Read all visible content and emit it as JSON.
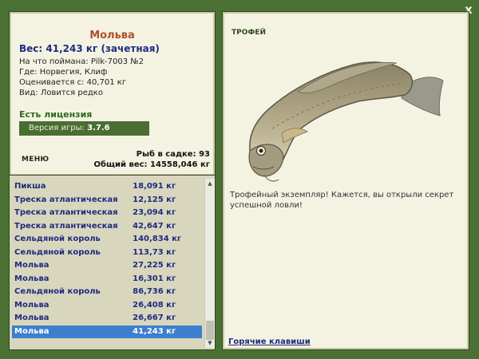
{
  "close_label": "x",
  "fish": {
    "name": "Мольва",
    "weight": "Вес: 41,243 кг (зачетная)",
    "lure": "На что поймана: Pilk-7003 №2",
    "where": "Где: Норвегия, Клиф",
    "value": "Оценивается с: 40,701 кг",
    "kind": "Вид: Ловится редко"
  },
  "license": "Есть лицензия",
  "version_label": "Версия игры:",
  "version": "3.7.6",
  "menu": "МЕНЮ",
  "stats": {
    "count": "Рыб в садке: 93",
    "total": "Общий вес: 14558,046 кг"
  },
  "catch_list": [
    {
      "name": "Пикша",
      "weight": "18,091 кг"
    },
    {
      "name": "Треска атлантическая",
      "weight": "12,125 кг"
    },
    {
      "name": "Треска атлантическая",
      "weight": "23,094 кг"
    },
    {
      "name": "Треска атлантическая",
      "weight": "42,647 кг"
    },
    {
      "name": "Сельдяной король",
      "weight": "140,834 кг"
    },
    {
      "name": "Сельдяной король",
      "weight": "113,73 кг"
    },
    {
      "name": "Мольва",
      "weight": "27,225 кг"
    },
    {
      "name": "Мольва",
      "weight": "16,301 кг"
    },
    {
      "name": "Сельдяной король",
      "weight": "86,736 кг"
    },
    {
      "name": "Мольва",
      "weight": "26,408 кг"
    },
    {
      "name": "Мольва",
      "weight": "26,667 кг"
    },
    {
      "name": "Мольва",
      "weight": "41,243 кг",
      "selected": true
    }
  ],
  "trophy_label": "ТРОФЕЙ",
  "trophy_message": "Трофейный экземпляр! Кажется, вы открыли секрет успешной ловли!",
  "hotkeys": "Горячие клавиши",
  "colors": {
    "frame": "#4a7034",
    "panel": "#f4f3e2",
    "list": "#d8d7bd",
    "selected": "#3c7fce",
    "fish_name": "#b0502a",
    "weight": "#1f2a80"
  }
}
